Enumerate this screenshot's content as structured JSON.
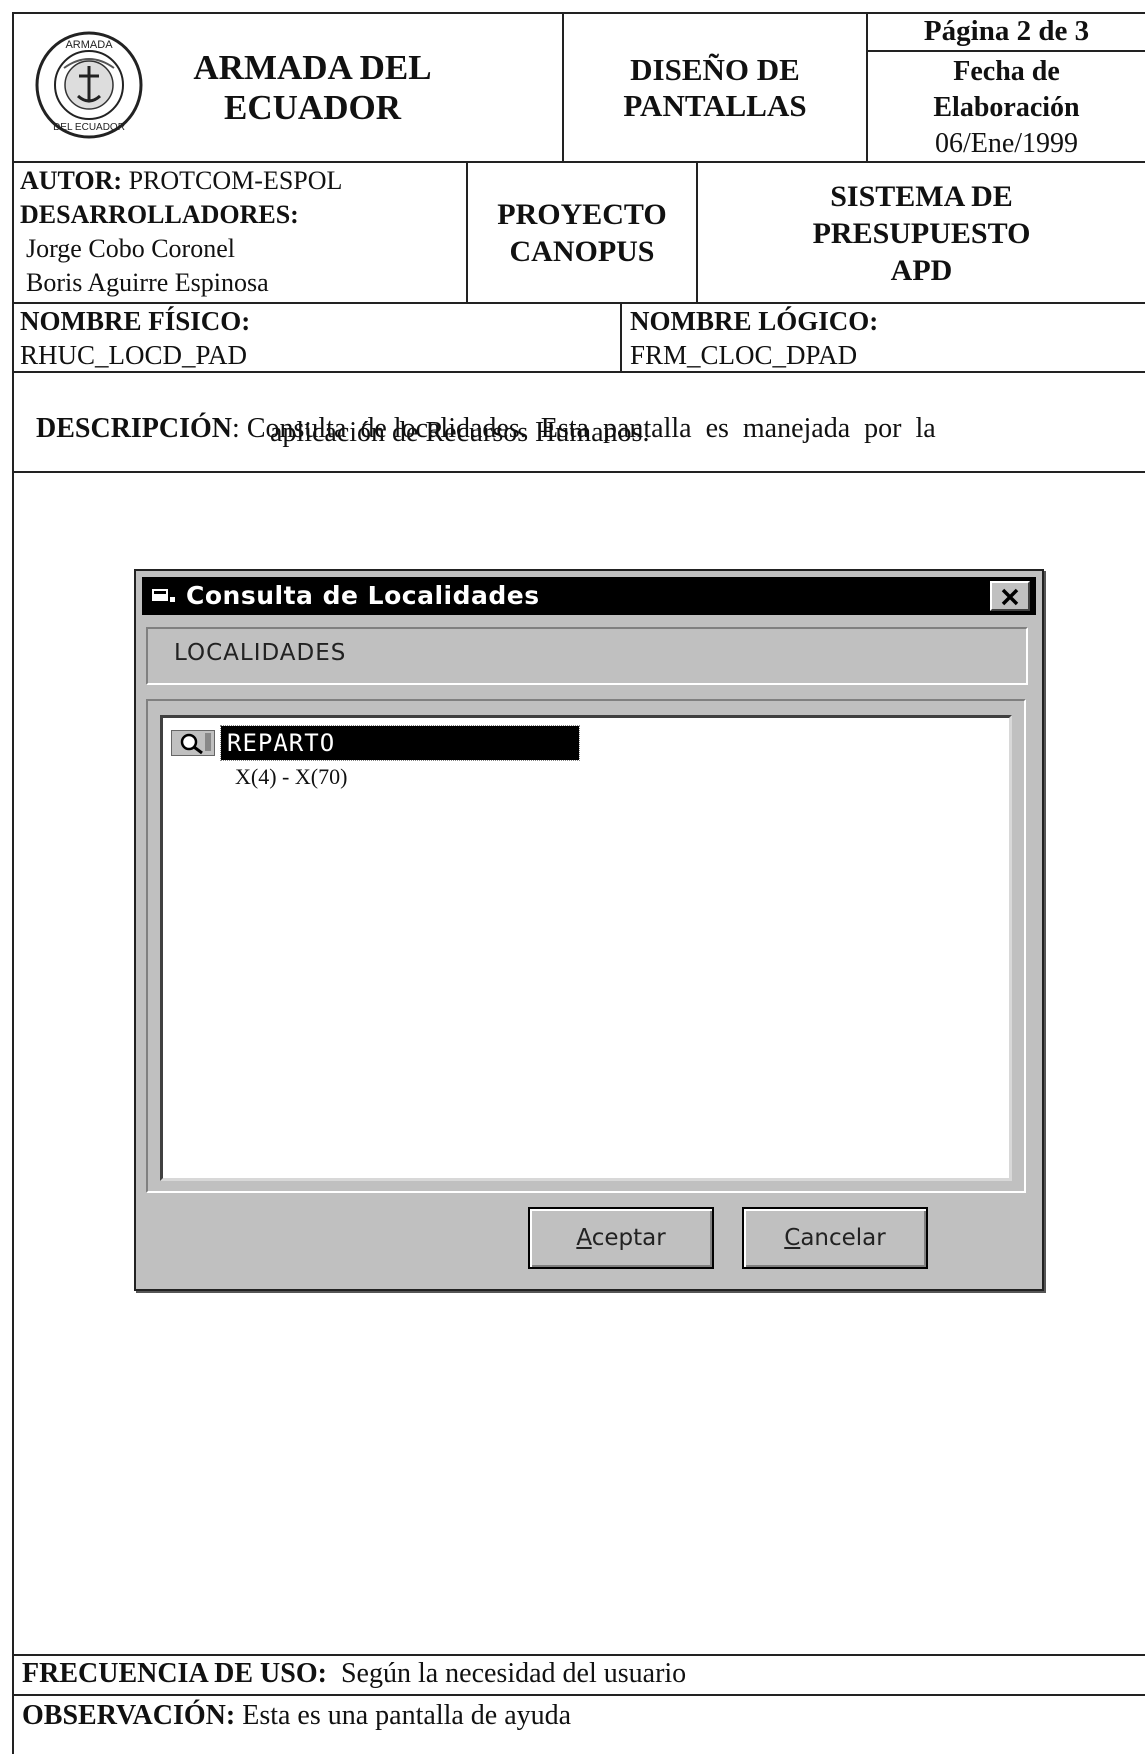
{
  "header": {
    "org_name_line1": "ARMADA DEL",
    "org_name_line2": "ECUADOR",
    "seal_text_top": "ARMADA",
    "seal_text_bottom": "DEL ECUADOR",
    "doc_type_line1": "DISEÑO DE",
    "doc_type_line2": "PANTALLAS",
    "page_label": "Página 2 de 3",
    "date_label_line1": "Fecha de",
    "date_label_line2": "Elaboración",
    "date_value": "06/Ene/1999"
  },
  "authors": {
    "autor_label": "AUTOR:",
    "autor_value": "PROTCOM-ESPOL",
    "dev_label": "DESARROLLADORES:",
    "dev1": "Jorge Cobo Coronel",
    "dev2": "Boris Aguirre Espinosa",
    "project_line1": "PROYECTO",
    "project_line2": "CANOPUS",
    "system_line1": "SISTEMA DE",
    "system_line2": "PRESUPUESTO",
    "system_line3": "APD"
  },
  "names": {
    "fisico_label": "NOMBRE FÍSICO:",
    "fisico_value": "RHUC_LOCD_PAD",
    "logico_label": "NOMBRE LÓGICO:",
    "logico_value": "FRM_CLOC_DPAD"
  },
  "description": {
    "label": "DESCRIPCIÓN",
    "line1": "Consulta  de localidades.  Esta  pantalla  es  manejada  por  la",
    "line2": "aplicación de Recursos Humanos."
  },
  "dialog": {
    "title": "Consulta de Localidades",
    "panel_label": "LOCALIDADES",
    "tree_item_label": "REPARTO",
    "tree_item_format": "X(4)  - X(70)",
    "accept_button": "Aceptar",
    "accept_hotkey": "A",
    "accept_rest": "ceptar",
    "cancel_button": "Cancelar",
    "cancel_hotkey": "C",
    "cancel_rest": "ancelar"
  },
  "footer": {
    "frequency_label": "FRECUENCIA DE USO:",
    "frequency_value": "Según la necesidad del usuario",
    "observation_label": "OBSERVACIÓN:",
    "observation_value": "Esta es una pantalla de ayuda"
  }
}
